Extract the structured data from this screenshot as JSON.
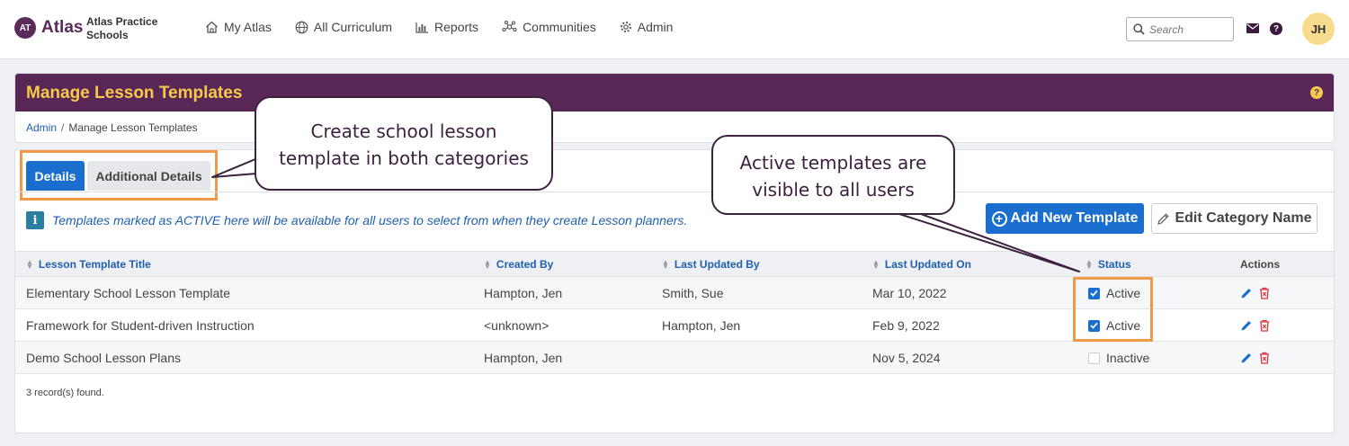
{
  "topbar": {
    "logo_badge": "AT",
    "logo_text": "Atlas",
    "school_name": "Atlas Practice Schools",
    "nav": [
      {
        "label": "My Atlas",
        "icon": "home-icon"
      },
      {
        "label": "All Curriculum",
        "icon": "globe-icon"
      },
      {
        "label": "Reports",
        "icon": "bar-chart-icon"
      },
      {
        "label": "Communities",
        "icon": "network-icon"
      },
      {
        "label": "Admin",
        "icon": "gear-icon"
      }
    ],
    "search_placeholder": "Search",
    "help_label": "?",
    "avatar_initials": "JH"
  },
  "header": {
    "title": "Manage Lesson Templates",
    "help_label": "?",
    "breadcrumb": {
      "root": "Admin",
      "separator": "/",
      "current": "Manage Lesson Templates"
    }
  },
  "tabs": [
    {
      "label": "Details",
      "active": true
    },
    {
      "label": "Additional Details",
      "active": false
    }
  ],
  "info": {
    "icon_label": "i",
    "text": "Templates marked as ACTIVE here will be available for all users to select from when they create Lesson planners."
  },
  "buttons": {
    "add_label": "Add New Template",
    "add_symbol": "+",
    "edit_label": "Edit Category Name"
  },
  "table": {
    "columns": [
      "Lesson Template Title",
      "Created By",
      "Last Updated By",
      "Last Updated On",
      "Status",
      "Actions"
    ],
    "rows": [
      {
        "title": "Elementary School Lesson Template",
        "created_by": "Hampton, Jen",
        "updated_by": "Smith, Sue",
        "updated_on": "Mar 10, 2022",
        "status": "Active",
        "checked": true
      },
      {
        "title": "Framework for Student-driven Instruction",
        "created_by": "<unknown>",
        "updated_by": "Hampton, Jen",
        "updated_on": "Feb 9, 2022",
        "status": "Active",
        "checked": true
      },
      {
        "title": "Demo School Lesson Plans",
        "created_by": "Hampton, Jen",
        "updated_by": "",
        "updated_on": "Nov 5, 2024",
        "status": "Inactive",
        "checked": false
      }
    ],
    "record_count": "3 record(s) found."
  },
  "callouts": {
    "tabs_note_line1": "Create school lesson",
    "tabs_note_line2": "template in both categories",
    "status_note_line1": "Active templates are",
    "status_note_line2": "visible to all users"
  },
  "colors": {
    "brand_purple": "#582756",
    "title_yellow": "#f7c94b",
    "primary_blue": "#1a6fce",
    "highlight_orange": "#f19849",
    "delete_red": "#d9363e"
  }
}
